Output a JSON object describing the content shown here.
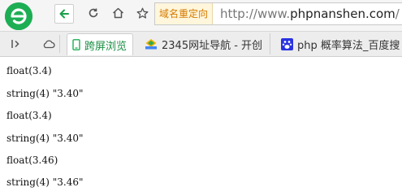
{
  "toolbar": {
    "redirect_badge": "域名重定向",
    "url_scheme": "http://www.",
    "url_host": "phpnanshen.com",
    "url_path": "/"
  },
  "tabs": [
    {
      "label": "跨屏浏览",
      "icon": "phone-icon",
      "active": true
    },
    {
      "label": "2345网址导航 - 开创",
      "icon": "2345-site-icon",
      "active": false
    },
    {
      "label": "php 概率算法_百度搜",
      "icon": "baidu-paw-icon",
      "active": false
    }
  ],
  "output_lines": [
    "float(3.4)",
    "string(4) \"3.40\"",
    "float(3.4)",
    "string(4) \"3.40\"",
    "float(3.46)",
    "string(4) \"3.46\""
  ]
}
